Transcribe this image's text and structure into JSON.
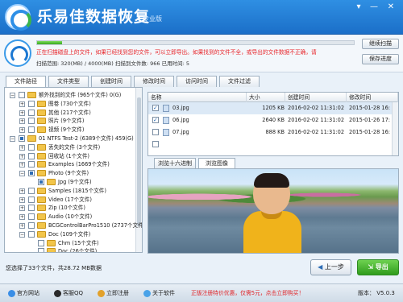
{
  "app": {
    "title": "乐易佳数据恢复",
    "edition": "专业版"
  },
  "window_controls": {
    "menu": "▾",
    "minimize": "—",
    "close": "✕"
  },
  "scan": {
    "progress_percent": 8,
    "message": "正在扫描磁盘上的文件，如果已经找到您的文件，可以立即导出。如果找到的文件不全，或导出的文件数据不正确，请",
    "stats": "扫描范围: 320(MB) / 4000(MB)     扫描到文件数: 966     已用时间: 5",
    "continue_button": "继续扫描",
    "save_button": "保存进度"
  },
  "tabs": [
    "文件路径",
    "文件类型",
    "创建时间",
    "修改时间",
    "访问时间",
    "文件过滤"
  ],
  "tree": [
    {
      "label": "额外找到的文件    (965个文件) 0(G)",
      "level": 0,
      "expander": "−",
      "checked": false
    },
    {
      "label": "图卷    (730个文件)",
      "level": 1,
      "expander": "+",
      "checked": false
    },
    {
      "label": "其他    (217个文件)",
      "level": 1,
      "expander": "+",
      "checked": false
    },
    {
      "label": "照片    (9个文件)",
      "level": 1,
      "expander": "+",
      "checked": false
    },
    {
      "label": "视频    (9个文件)",
      "level": 1,
      "expander": "+",
      "checked": false
    },
    {
      "label": "01  NTFS  Test-2    (6389个文件)  459(G)",
      "level": 0,
      "expander": "−",
      "checked": true
    },
    {
      "label": "丢失的文件    (3个文件)",
      "level": 1,
      "expander": "+",
      "checked": false
    },
    {
      "label": "回收站    (1个文件)",
      "level": 1,
      "expander": "+",
      "checked": false
    },
    {
      "label": "Examples    (1669个文件)",
      "level": 1,
      "expander": "+",
      "checked": false
    },
    {
      "label": "Photo    (9个文件)",
      "level": 1,
      "expander": "−",
      "checked": true
    },
    {
      "label": "Jpg    (9个文件)",
      "level": 2,
      "expander": "",
      "checked": true
    },
    {
      "label": "Samples    (1815个文件)",
      "level": 1,
      "expander": "+",
      "checked": false
    },
    {
      "label": "Video    (17个文件)",
      "level": 1,
      "expander": "+",
      "checked": false
    },
    {
      "label": "Zip    (10个文件)",
      "level": 1,
      "expander": "+",
      "checked": false
    },
    {
      "label": "Audio    (10个文件)",
      "level": 1,
      "expander": "+",
      "checked": false
    },
    {
      "label": "BCGControlBarPro1510    (2737个文件)",
      "level": 1,
      "expander": "+",
      "checked": false
    },
    {
      "label": "Doc    (109个文件)",
      "level": 1,
      "expander": "−",
      "checked": false
    },
    {
      "label": "Chm    (15个文件)",
      "level": 2,
      "expander": "",
      "checked": false
    },
    {
      "label": "Doc    (26个文件)",
      "level": 2,
      "expander": "",
      "checked": false
    }
  ],
  "file_list": {
    "columns": [
      "名称",
      "大小",
      "创建时间",
      "修改时间"
    ],
    "rows": [
      {
        "name": "03.jpg",
        "size": "1205 KB",
        "created": "2016-02-02  11:31:02",
        "modified": "2015-01-28  16:",
        "checked": true,
        "selected": true
      },
      {
        "name": "06.jpg",
        "size": "2640 KB",
        "created": "2016-02-02  11:31:02",
        "modified": "2015-01-26  17:",
        "checked": true,
        "selected": false
      },
      {
        "name": "07.jpg",
        "size": "888 KB",
        "created": "2016-02-02  11:31:02",
        "modified": "2015-01-28  16:",
        "checked": false,
        "selected": false
      },
      {
        "name": "",
        "size": "",
        "created": "",
        "modified": "",
        "checked": false,
        "selected": false
      }
    ]
  },
  "preview_tabs": [
    "浏览十六进制",
    "浏览图像"
  ],
  "selection_status": "您选择了33个文件，共28.72 MB数据",
  "buttons": {
    "prev": "上一步",
    "export": "导出"
  },
  "footer": {
    "website": "官方网站",
    "qq": "客服QQ",
    "register": "立即注册",
    "about": "关于软件",
    "promo": "正版注册特价优惠，仅需5元，点击立即购买！",
    "version": "版本： V5.0.3"
  },
  "colors": {
    "accent": "#1f74cf",
    "error_text": "#e8262b",
    "export_green": "#3aa823"
  }
}
